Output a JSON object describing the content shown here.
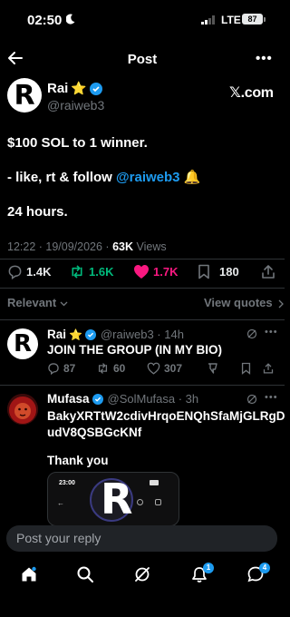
{
  "status_bar": {
    "time": "02:50",
    "network": "LTE",
    "battery": "87"
  },
  "header": {
    "title": "Post",
    "back_icon": "arrow-left-icon",
    "more_label": "•••"
  },
  "post": {
    "author_name": "Rai",
    "author_emoji": "⭐",
    "author_handle": "@raiweb3",
    "avatar_letter": "R",
    "source": "𝕏.com",
    "line1": "$100 SOL to 1 winner.",
    "line2_prefix": "- like, rt & follow ",
    "line2_mention": "@raiweb3",
    "line2_emoji": "🔔",
    "line3": "24 hours.",
    "timestamp": "12:22 · 19/09/2026 · ",
    "views_count": "63K",
    "views_label": " Views",
    "replies": "1.4K",
    "reposts": "1.6K",
    "likes": "1.7K",
    "bookmarks": "180"
  },
  "sort": {
    "label": "Relevant",
    "view_quotes": "View quotes"
  },
  "replies": [
    {
      "name": "Rai",
      "emoji": "⭐",
      "meta": "@raiweb3 · 14h",
      "text": "JOIN THE GROUP (IN MY BIO)",
      "avatar_letter": "R",
      "replies": "87",
      "reposts": "60",
      "likes": "307"
    },
    {
      "name": "Mufasa",
      "meta": "@SolMufasa · 3h",
      "text_line1": "BakyXRTtW2cdivHrqoENQhSfaMjGLRgD",
      "text_line2": "udV8QSBGcKNf",
      "text_line3": "Thank you",
      "embed_time": "23:00",
      "embed_letter": "R"
    }
  ],
  "composer": {
    "placeholder": "Post your reply"
  },
  "bottom_nav": {
    "notifications_badge": "1",
    "messages_badge": "4"
  },
  "colors": {
    "accent": "#1d9bf0",
    "like": "#f91880",
    "repost": "#00ba7c"
  }
}
